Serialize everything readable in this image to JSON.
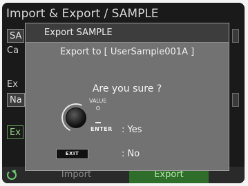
{
  "background": {
    "title": "Import & Export / SAMPLE",
    "rows": [
      "SA",
      "Ca",
      "Ex",
      "Na"
    ],
    "export_button": "Ex"
  },
  "tabs": {
    "import": "Import",
    "export": "Export"
  },
  "dialog": {
    "title": "Export SAMPLE",
    "export_to": "Export to [ UserSample001A ]",
    "question": "Are you sure ?",
    "value_label": "VALUE",
    "enter_label": "ENTER",
    "yes": ": Yes",
    "exit_label": "EXIT",
    "no": ": No"
  },
  "colors": {
    "dialog_bg": "#727272",
    "header_bg": "#3d3d3d",
    "export_tab": "#2e6e2a",
    "accent_green": "#6cc86a"
  },
  "icons": {
    "refresh": "refresh-icon",
    "knob": "value-knob-icon"
  }
}
